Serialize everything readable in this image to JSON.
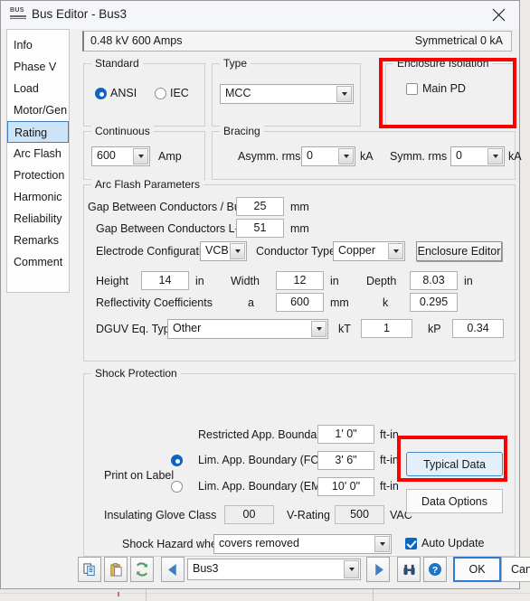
{
  "window": {
    "title": "Bus Editor - Bus3",
    "app_icon": "bus-icon",
    "close_label": "✕"
  },
  "header": {
    "left": "0.48 kV 600 Amps",
    "right": "Symmetrical 0 kA"
  },
  "sidebar": {
    "items": [
      {
        "label": "Info",
        "selected": false
      },
      {
        "label": "Phase V",
        "selected": false
      },
      {
        "label": "Load",
        "selected": false
      },
      {
        "label": "Motor/Gen",
        "selected": false
      },
      {
        "label": "Rating",
        "selected": true
      },
      {
        "label": "Arc Flash",
        "selected": false
      },
      {
        "label": "Protection",
        "selected": false
      },
      {
        "label": "Harmonic",
        "selected": false
      },
      {
        "label": "Reliability",
        "selected": false
      },
      {
        "label": "Remarks",
        "selected": false
      },
      {
        "label": "Comment",
        "selected": false
      }
    ]
  },
  "standard": {
    "legend": "Standard",
    "ansi_label": "ANSI",
    "iec_label": "IEC",
    "selected": "ANSI"
  },
  "type": {
    "legend": "Type",
    "value": "MCC"
  },
  "enclosure_isolation": {
    "legend": "Enclosure Isolation",
    "main_pd_label": "Main PD",
    "main_pd_checked": false,
    "highlighted": true
  },
  "continuous": {
    "legend": "Continuous",
    "value": "600",
    "unit": "Amp"
  },
  "bracing": {
    "legend": "Bracing",
    "asymm_label": "Asymm. rms",
    "asymm_value": "0",
    "asymm_unit": "kA",
    "symm_label": "Symm. rms",
    "symm_value": "0",
    "symm_unit": "kA"
  },
  "arc_flash": {
    "legend": "Arc Flash Parameters",
    "gap_buses_label": "Gap Between Conductors / Buses",
    "gap_buses_value": "25",
    "gap_buses_unit": "mm",
    "gap_lg_label": "Gap Between Conductors L-G",
    "gap_lg_value": "51",
    "gap_lg_unit": "mm",
    "electrode_label": "Electrode Configuration",
    "electrode_value": "VCB",
    "conductor_label": "Conductor Type",
    "conductor_value": "Copper",
    "enclosure_editor_label": "Enclosure Editor",
    "height_label": "Height",
    "height_value": "14",
    "height_unit": "in",
    "width_label": "Width",
    "width_value": "12",
    "width_unit": "in",
    "depth_label": "Depth",
    "depth_value": "8.03",
    "depth_unit": "in",
    "reflectivity_label": "Reflectivity Coefficients",
    "a_label": "a",
    "a_value": "600",
    "a_unit": "mm",
    "k_label": "k",
    "k_value": "0.295",
    "dguv_label": "DGUV Eq. Type",
    "dguv_value": "Other",
    "kt_label": "kT",
    "kt_value": "1",
    "kp_label": "kP",
    "kp_value": "0.34"
  },
  "shock_protection": {
    "legend": "Shock Protection",
    "restricted_label": "Restricted App. Boundary",
    "restricted_value": "1' 0\"",
    "restricted_unit": "ft-in",
    "fcp_label": "Lim. App. Boundary (FCP)",
    "fcp_value": "3' 6\"",
    "fcp_unit": "ft-in",
    "emc_label": "Lim. App. Boundary (EMC)",
    "emc_value": "10' 0\"",
    "emc_unit": "ft-in",
    "print_on_label": "Print on Label",
    "print_selected": "FCP",
    "glove_label": "Insulating Glove Class",
    "glove_value": "00",
    "vrating_label": "V-Rating",
    "vrating_value": "500",
    "vrating_unit": "VAC",
    "hazard_label": "Shock Hazard when",
    "hazard_value": "covers removed",
    "typical_data_label": "Typical Data",
    "typical_data_highlighted": true,
    "data_options_label": "Data Options",
    "auto_update_label": "Auto Update",
    "auto_update_checked": true
  },
  "bottom_bar": {
    "copy_icon": "copy-icon",
    "paste_icon": "paste-icon",
    "refresh_icon": "refresh-icon",
    "prev_icon": "previous-arrow-icon",
    "next_icon": "next-arrow-icon",
    "find_icon": "binoculars-find-icon",
    "help_icon": "help-icon",
    "selector_value": "Bus3",
    "ok_label": "OK",
    "cancel_label": "Cancel"
  },
  "colors": {
    "accent": "#0a66c2",
    "annotation": "#fb0000",
    "selection": "#cde3f7",
    "focus": "#2b7cd3"
  }
}
